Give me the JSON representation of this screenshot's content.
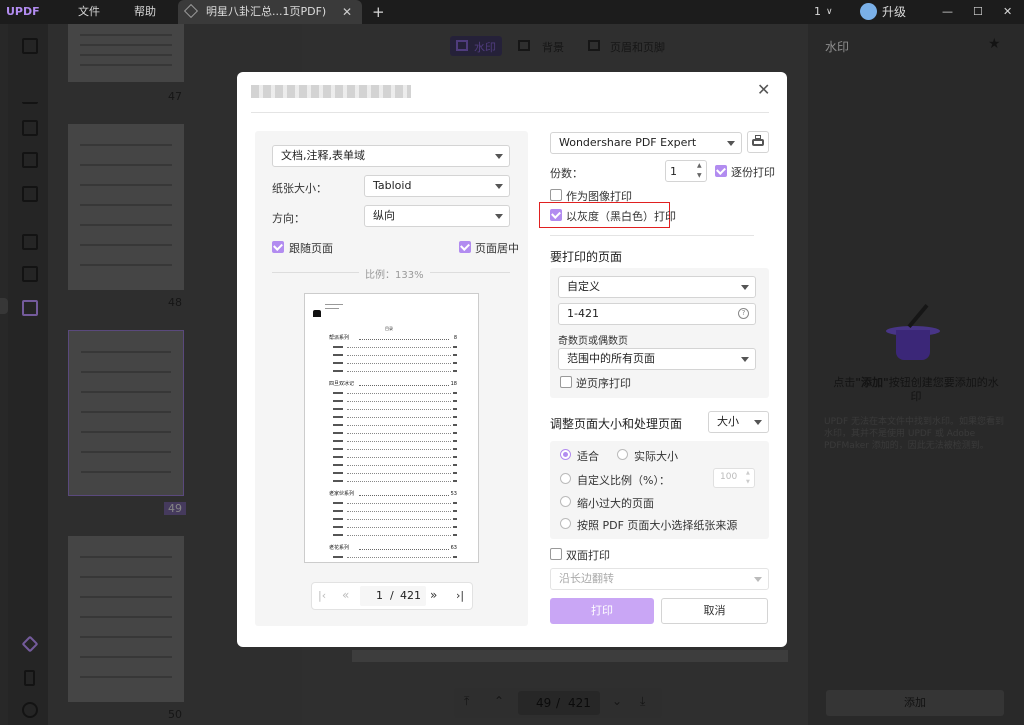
{
  "titlebar": {
    "brand": "UPDF",
    "menu_file": "文件",
    "menu_help": "帮助",
    "tab_title": "明星八卦汇总...1页PDF)",
    "window_count": "1",
    "upgrade": "升级"
  },
  "center_toolbar": {
    "watermark": "水印",
    "background": "背景",
    "header_footer": "页眉和页脚"
  },
  "thumbnails": {
    "labels": [
      "47",
      "48",
      "49",
      "50"
    ]
  },
  "bottom_nav": {
    "current": "49",
    "sep": "/",
    "total": "421"
  },
  "right_panel": {
    "title": "水印",
    "hint_prefix": "点击",
    "hint_add": "\"添加\"",
    "hint_suffix": "按钮创建您要添加的水印",
    "info": "UPDF 无法在本文件中找到水印。如果您看到水印，其并不是使用 UPDF 或 Adobe PDFMaker 添加的，因此无法被检测到。",
    "add_button": "添加"
  },
  "dialog": {
    "content_select": "文档,注释,表单域",
    "paper_size_label": "纸张大小：",
    "paper_size_value": "Tabloid",
    "orientation_label": "方向：",
    "orientation_value": "纵向",
    "follow_page": "跟随页面",
    "center_page": "页面居中",
    "scale_text": "比例：133%",
    "preview": {
      "doc_title": "目录",
      "sections": [
        {
          "title": "帮派系列",
          "num": "8",
          "items": 4
        },
        {
          "title": "四旦双冰记",
          "num": "18",
          "items": 12
        },
        {
          "title": "老家伙系列",
          "num": "53",
          "items": 5
        },
        {
          "title": "老花系列",
          "num": "63",
          "items": 1
        }
      ]
    },
    "pager": {
      "current": "1",
      "sep": "/",
      "total": "421"
    },
    "printer": "Wondershare PDF Expert",
    "copies_label": "份数：",
    "copies_value": "1",
    "collate": "逐份打印",
    "print_as_image": "作为图像打印",
    "grayscale": "以灰度（黑白色）打印",
    "pages_to_print_title": "要打印的页面",
    "range_mode": "自定义",
    "range_value": "1-421",
    "odd_even_label": "奇数页或偶数页",
    "odd_even_value": "范围中的所有页面",
    "reverse_order": "逆页序打印",
    "size_handling_title": "调整页面大小和处理页面",
    "size_mode": "大小",
    "fit": "适合",
    "actual_size": "实际大小",
    "custom_scale": "自定义比例（%）：",
    "custom_scale_value": "100",
    "shrink_oversized": "缩小过大的页面",
    "choose_source": "按照 PDF 页面大小选择纸张来源",
    "duplex": "双面打印",
    "flip_on": "沿长边翻转",
    "print_button": "打印",
    "cancel_button": "取消"
  },
  "colors": {
    "accent": "#b28cf0",
    "highlight_border": "#e02020",
    "overlay": "rgba(0,0,0,0.55)"
  }
}
